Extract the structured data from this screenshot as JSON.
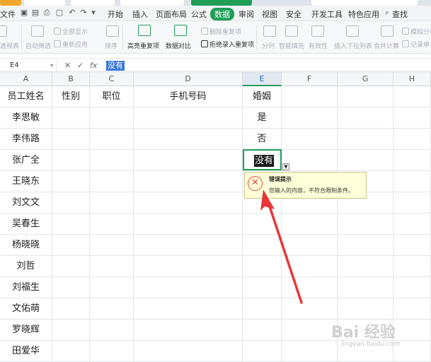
{
  "menu": {
    "items": [
      "文件",
      "开始",
      "插入",
      "页面布局",
      "公式",
      "数据",
      "审阅",
      "视图",
      "安全",
      "开发工具",
      "特色应用",
      "查找"
    ],
    "active_tab": "数据",
    "colors": {
      "active_bg": "#1f9e58",
      "active_text": "#ffffff"
    }
  },
  "ribbon": {
    "groups": [
      {
        "label": "透视表",
        "enabled": false
      },
      {
        "label": "自动筛选",
        "enabled": false
      },
      {
        "label": "全部显示",
        "enabled": false
      },
      {
        "label": "重新应用",
        "enabled": false
      },
      {
        "label": "排序",
        "enabled": false
      },
      {
        "label": "高亮重复项",
        "enabled": true,
        "icon": "highlight-duplicates-icon"
      },
      {
        "label": "数据对比",
        "enabled": true,
        "icon": "data-compare-icon"
      },
      {
        "label": "删除重复项",
        "enabled": false
      },
      {
        "label": "拒绝录入重复项",
        "enabled": true
      },
      {
        "label": "分列",
        "enabled": false
      },
      {
        "label": "智能填充",
        "enabled": false
      },
      {
        "label": "有效性",
        "enabled": false
      },
      {
        "label": "插入下拉列表",
        "enabled": false
      },
      {
        "label": "合并计算",
        "enabled": false
      },
      {
        "label": "模拟分析",
        "enabled": false
      },
      {
        "label": "记录单",
        "enabled": false
      }
    ]
  },
  "formula_bar": {
    "cell_ref": "E4",
    "content": "没有",
    "icons": [
      "cancel-icon",
      "confirm-icon",
      "function-icon"
    ]
  },
  "sheet": {
    "columns": [
      "A",
      "B",
      "C",
      "D",
      "E",
      "F",
      "G",
      "H"
    ],
    "selected_column": "E",
    "header_row": [
      "员工姓名",
      "性别",
      "职位",
      "手机号码",
      "婚姻",
      "",
      "",
      ""
    ],
    "rows": [
      [
        "李思敏",
        "",
        "",
        "",
        "是"
      ],
      [
        "李伟路",
        "",
        "",
        "",
        "否"
      ],
      [
        "张广全",
        "",
        "",
        "",
        "没有"
      ],
      [
        "王晓东",
        "",
        "",
        "",
        ""
      ],
      [
        "刘文文",
        "",
        "",
        "",
        ""
      ],
      [
        "吴春生",
        "",
        "",
        "",
        ""
      ],
      [
        "杨晓晓",
        "",
        "",
        "",
        ""
      ],
      [
        "刘哲",
        "",
        "",
        "",
        ""
      ],
      [
        "刘福生",
        "",
        "",
        "",
        ""
      ],
      [
        "文佑萌",
        "",
        "",
        "",
        ""
      ],
      [
        "罗晓辉",
        "",
        "",
        "",
        ""
      ],
      [
        "田爱华",
        "",
        "",
        "",
        ""
      ]
    ],
    "active_cell": {
      "ref": "E4",
      "value": "没有"
    }
  },
  "error_tooltip": {
    "icon": "error-x-icon",
    "title": "错误提示",
    "message": "您输入的内容，不符合限制条件。"
  },
  "annotation": {
    "arrow_color": "#e8363a"
  },
  "watermark": {
    "text": "Bai 经验",
    "sub": "jingyan.baidu.com"
  }
}
